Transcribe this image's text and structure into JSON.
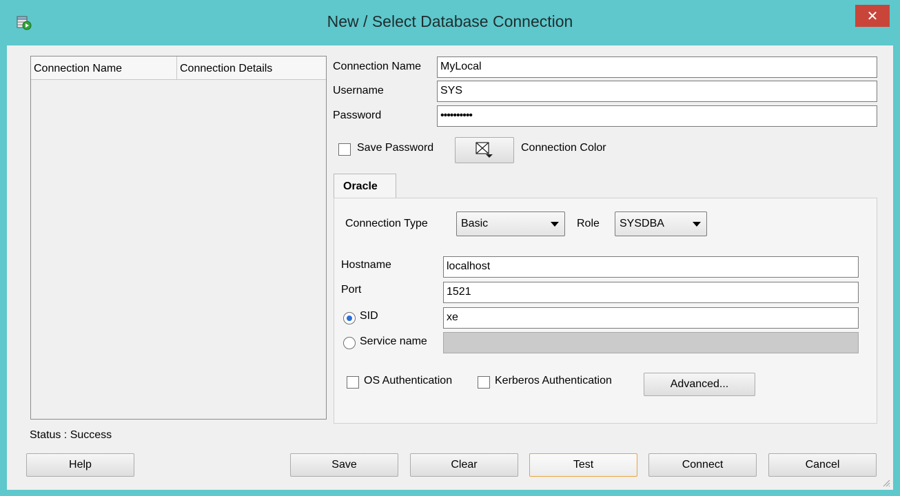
{
  "window": {
    "title": "New / Select Database Connection",
    "close_label": "✕"
  },
  "connections_table": {
    "columns": [
      "Connection Name",
      "Connection Details"
    ],
    "rows": []
  },
  "form": {
    "connection_name_label": "Connection Name",
    "connection_name_value": "MyLocal",
    "username_label": "Username",
    "username_value": "SYS",
    "password_label": "Password",
    "password_value": "••••••••••",
    "save_password_label": "Save Password",
    "save_password_checked": false,
    "connection_color_label": "Connection Color"
  },
  "tab": {
    "label": "Oracle"
  },
  "oracle": {
    "connection_type_label": "Connection Type",
    "connection_type_value": "Basic",
    "role_label": "Role",
    "role_value": "SYSDBA",
    "hostname_label": "Hostname",
    "hostname_value": "localhost",
    "port_label": "Port",
    "port_value": "1521",
    "sid_label": "SID",
    "sid_value": "xe",
    "service_name_label": "Service name",
    "service_name_value": "",
    "os_auth_label": "OS Authentication",
    "kerberos_auth_label": "Kerberos Authentication",
    "advanced_label": "Advanced..."
  },
  "status": {
    "text": "Status : Success"
  },
  "buttons": {
    "help": "Help",
    "save": "Save",
    "clear": "Clear",
    "test": "Test",
    "connect": "Connect",
    "cancel": "Cancel"
  },
  "colors": {
    "titlebar": "#5ec8cc",
    "close_button": "#c9453a",
    "focus_border": "#e8a33c",
    "radio_dot": "#2a6fd6"
  }
}
